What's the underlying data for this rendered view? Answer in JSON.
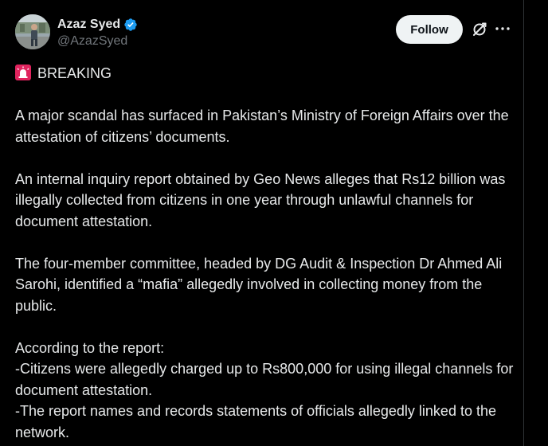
{
  "author": {
    "display_name": "Azaz Syed",
    "handle": "@AzazSyed",
    "verified_icon": "verified-badge-icon",
    "avatar_icon": "avatar-photo"
  },
  "actions": {
    "follow_label": "Follow",
    "grok_icon": "grok-icon",
    "more_icon": "more-options-icon"
  },
  "colors": {
    "background": "#000000",
    "text": "#e7e9ea",
    "muted": "#71767b",
    "verified": "#1d9bf0",
    "follow_bg": "#eff3f4",
    "siren": "#e0245e"
  },
  "post": {
    "breaking_icon": "rotating-light-emoji",
    "breaking_label": "BREAKING",
    "paragraphs": [
      "A major scandal has surfaced in Pakistan’s Ministry of Foreign Affairs over the attestation of citizens’ documents.",
      "An internal inquiry report obtained by Geo News alleges that Rs12 billion was illegally collected from citizens in one year through unlawful channels for document attestation.",
      "The four-member committee, headed by DG Audit & Inspection Dr Ahmed Ali Sarohi, identified a “mafia” allegedly involved in collecting money from the public."
    ],
    "report_intro": "According to the report:",
    "report_points": [
      "-Citizens were allegedly charged up to Rs800,000 for using illegal channels for document attestation.",
      "-The report names and records statements of officials allegedly linked to the network."
    ]
  }
}
